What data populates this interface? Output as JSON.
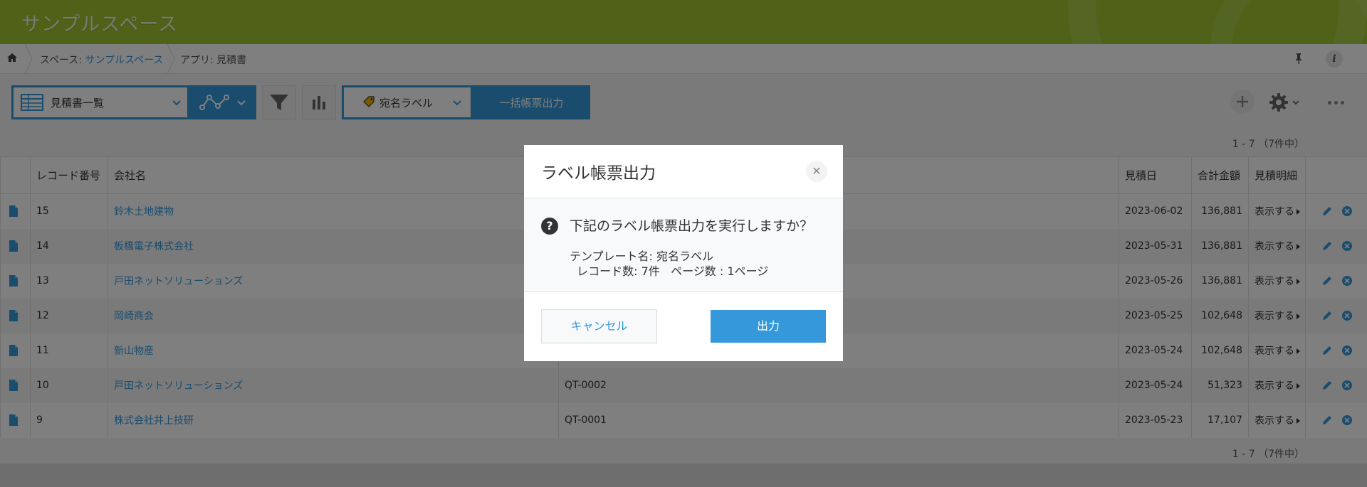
{
  "header": {
    "space_name": "サンプルスペース"
  },
  "breadcrumb": {
    "space_prefix": "スペース: ",
    "space_link": "サンプルスペース",
    "app": "アプリ: 見積書"
  },
  "toolbar": {
    "view_name": "見積書一覧",
    "label_template": "宛名ラベル",
    "bulk_print": "一括帳票出力",
    "icons": [
      "home-icon",
      "table-view-icon",
      "graph-icon",
      "filter-icon",
      "bar-chart-icon",
      "tag-icon",
      "plus-icon",
      "gear-icon",
      "more-icon",
      "pin-icon",
      "info-icon"
    ]
  },
  "pager": {
    "top": "1 - 7 （7件中）",
    "bottom": "1 - 7 （7件中）"
  },
  "table": {
    "columns": [
      "",
      "レコード番号",
      "会社名",
      "",
      "見積日",
      "合計金額",
      "見積明細",
      ""
    ],
    "rows": [
      {
        "id": "15",
        "company": "鈴木土地建物",
        "quote_no": "",
        "date": "2023-06-02",
        "total": "136,881",
        "detail": "表示する"
      },
      {
        "id": "14",
        "company": "板橋電子株式会社",
        "quote_no": "",
        "date": "2023-05-31",
        "total": "136,881",
        "detail": "表示する"
      },
      {
        "id": "13",
        "company": "戸田ネットソリューションズ",
        "quote_no": "",
        "date": "2023-05-26",
        "total": "136,881",
        "detail": "表示する"
      },
      {
        "id": "12",
        "company": "岡崎商会",
        "quote_no": "",
        "date": "2023-05-25",
        "total": "102,648",
        "detail": "表示する"
      },
      {
        "id": "11",
        "company": "新山物産",
        "quote_no": "",
        "date": "2023-05-24",
        "total": "102,648",
        "detail": "表示する"
      },
      {
        "id": "10",
        "company": "戸田ネットソリューションズ",
        "quote_no": "QT-0002",
        "date": "2023-05-24",
        "total": "51,323",
        "detail": "表示する"
      },
      {
        "id": "9",
        "company": "株式会社井上技研",
        "quote_no": "QT-0001",
        "date": "2023-05-23",
        "total": "17,107",
        "detail": "表示する"
      }
    ]
  },
  "dialog": {
    "title": "ラベル帳票出力",
    "question": "下記のラベル帳票出力を実行しますか？",
    "template_line": "テンプレート名: 宛名ラベル",
    "record_line": "  レコード数: 7件   ページ数 : 1ページ",
    "cancel_label": "キャンセル",
    "output_label": "出力"
  },
  "colors": {
    "header": "#9ec430",
    "accent": "#3498db"
  }
}
